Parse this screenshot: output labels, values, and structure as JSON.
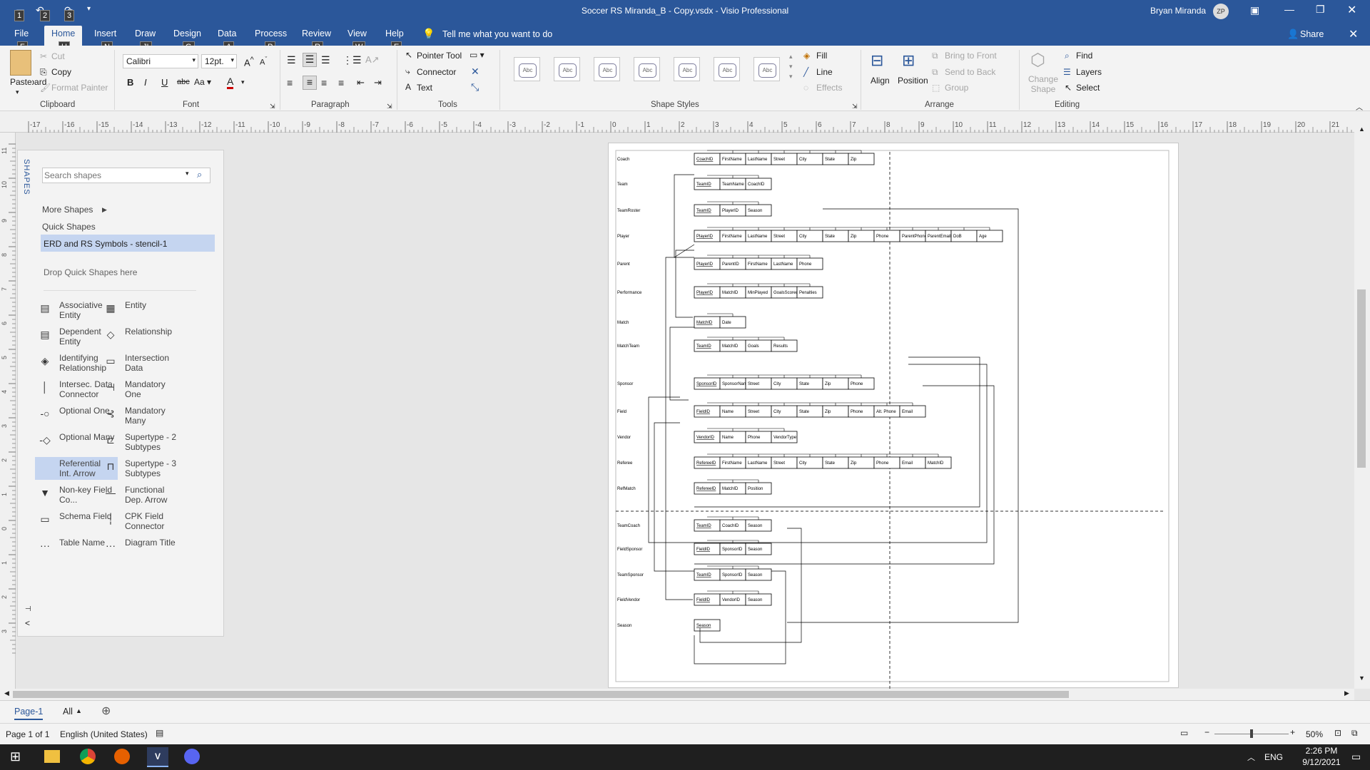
{
  "window": {
    "title": "Soccer RS Miranda_B - Copy.vsdx  -  Visio Professional",
    "user": "Bryan Miranda",
    "user_initials": "ZP"
  },
  "quick_access": {
    "keytips": [
      "1",
      "2",
      "3"
    ]
  },
  "tabs": [
    {
      "label": "File",
      "keytip": "F"
    },
    {
      "label": "Home",
      "keytip": "H"
    },
    {
      "label": "Insert",
      "keytip": "N"
    },
    {
      "label": "Draw",
      "keytip": "JI"
    },
    {
      "label": "Design",
      "keytip": "G"
    },
    {
      "label": "Data",
      "keytip": "A"
    },
    {
      "label": "Process",
      "keytip": "P"
    },
    {
      "label": "Review",
      "keytip": "R"
    },
    {
      "label": "View",
      "keytip": "W"
    },
    {
      "label": "Help",
      "keytip": "E"
    }
  ],
  "tell_me": "Tell me what you want to do",
  "share": "Share",
  "ribbon": {
    "clipboard": {
      "label": "Clipboard",
      "paste": "Paste",
      "cut": "Cut",
      "copy": "Copy",
      "format_painter": "Format Painter"
    },
    "font": {
      "label": "Font",
      "family": "Calibri",
      "size": "12pt."
    },
    "paragraph": {
      "label": "Paragraph"
    },
    "tools": {
      "label": "Tools",
      "pointer": "Pointer Tool",
      "connector": "Connector",
      "text": "Text"
    },
    "shape_styles": {
      "label": "Shape Styles",
      "sample": "Abc",
      "fill": "Fill",
      "line": "Line",
      "effects": "Effects"
    },
    "arrange": {
      "label": "Arrange",
      "align": "Align",
      "position": "Position",
      "bring_front": "Bring to Front",
      "send_back": "Send to Back",
      "group": "Group"
    },
    "editing": {
      "label": "Editing",
      "change_shape": "Change Shape",
      "find": "Find",
      "layers": "Layers",
      "select": "Select"
    }
  },
  "ruler_top_labels": [
    "-17",
    "-16",
    "-15",
    "-14",
    "-13",
    "-12",
    "-11",
    "-10",
    "-9",
    "-8",
    "-7",
    "-6",
    "-5",
    "-4",
    "-3",
    "-2",
    "-1",
    "0",
    "1",
    "2",
    "3",
    "4",
    "5",
    "6",
    "7",
    "8",
    "9",
    "10",
    "11",
    "12",
    "13",
    "14",
    "15",
    "16",
    "17",
    "18",
    "19",
    "20",
    "21",
    "22",
    "23",
    "24",
    "25"
  ],
  "ruler_left_labels": [
    "11",
    "10",
    "9",
    "8",
    "7",
    "6",
    "5",
    "4",
    "3",
    "2",
    "1",
    "0",
    "1",
    "2",
    "3"
  ],
  "shapes_panel": {
    "title": "SHAPES",
    "search_placeholder": "Search shapes",
    "more_shapes": "More Shapes",
    "quick_shapes": "Quick Shapes",
    "stencil": "ERD and RS Symbols - stencil-1",
    "drop_hint": "Drop Quick Shapes here",
    "items": [
      [
        "Associative Entity",
        "Entity"
      ],
      [
        "Dependent Entity",
        "Relationship"
      ],
      [
        "Identifying Relationship",
        "Intersection Data"
      ],
      [
        "Intersec. Data Connector",
        "Mandatory One"
      ],
      [
        "Optional One",
        "Mandatory Many"
      ],
      [
        "Optional Many",
        "Supertype - 2 Subtypes"
      ],
      [
        "Referential Int. Arrow",
        "Supertype - 3 Subtypes"
      ],
      [
        "Non-key Field Co...",
        "Functional Dep. Arrow"
      ],
      [
        "Schema Field",
        "CPK Field Connector"
      ],
      [
        "Table Name",
        "Diagram Title"
      ]
    ]
  },
  "diagram": {
    "tables": [
      {
        "name": "Coach",
        "fields": [
          "CoachID",
          "FirstName",
          "LastName",
          "Street",
          "City",
          "State",
          "Zip"
        ]
      },
      {
        "name": "Team",
        "fields": [
          "TeamID",
          "TeamName",
          "CoachID"
        ]
      },
      {
        "name": "TeamRoster",
        "fields": [
          "TeamID",
          "PlayerID",
          "Season"
        ]
      },
      {
        "name": "Player",
        "fields": [
          "PlayerID",
          "FirstName",
          "LastName",
          "Street",
          "City",
          "State",
          "Zip",
          "Phone",
          "ParentPhone",
          "ParentEmail",
          "DoB",
          "Age"
        ]
      },
      {
        "name": "Parent",
        "fields": [
          "PlayerID",
          "ParentID",
          "FirstName",
          "LastName",
          "Phone"
        ]
      },
      {
        "name": "Performance",
        "fields": [
          "PlayerID",
          "MatchID",
          "MinPlayed",
          "GoalsScored",
          "Penalties"
        ]
      },
      {
        "name": "Match",
        "fields": [
          "MatchID",
          "Date"
        ]
      },
      {
        "name": "MatchTeam",
        "fields": [
          "TeamID",
          "MatchID",
          "Goals",
          "Results"
        ]
      },
      {
        "name": "Sponsor",
        "fields": [
          "SponsorID",
          "SponsorName",
          "Street",
          "City",
          "State",
          "Zip",
          "Phone"
        ]
      },
      {
        "name": "Field",
        "fields": [
          "FieldID",
          "Name",
          "Street",
          "City",
          "State",
          "Zip",
          "Phone",
          "Alt. Phone",
          "Email"
        ]
      },
      {
        "name": "Vendor",
        "fields": [
          "VendorID",
          "Name",
          "Phone",
          "VendorType"
        ]
      },
      {
        "name": "Referee",
        "fields": [
          "RefereeID",
          "FirstName",
          "LastName",
          "Street",
          "City",
          "State",
          "Zip",
          "Phone",
          "Email",
          "MatchID"
        ]
      },
      {
        "name": "RefMatch",
        "fields": [
          "RefereeID",
          "MatchID",
          "Position"
        ]
      },
      {
        "name": "TeamCoach",
        "fields": [
          "TeamID",
          "CoachID",
          "Season"
        ]
      },
      {
        "name": "FieldSponsor",
        "fields": [
          "FieldID",
          "SponsorID",
          "Season"
        ]
      },
      {
        "name": "TeamSponsor",
        "fields": [
          "TeamID",
          "SponsorID",
          "Season"
        ]
      },
      {
        "name": "FieldVendor",
        "fields": [
          "FieldID",
          "VendorID",
          "Season"
        ]
      },
      {
        "name": "Season",
        "fields": [
          "Season"
        ]
      }
    ]
  },
  "page_tabs": {
    "current": "Page-1",
    "all": "All"
  },
  "status": {
    "page": "Page 1 of 1",
    "language": "English (United States)",
    "zoom": "50%"
  },
  "taskbar": {
    "lang": "ENG",
    "time": "2:26 PM",
    "date": "9/12/2021"
  }
}
